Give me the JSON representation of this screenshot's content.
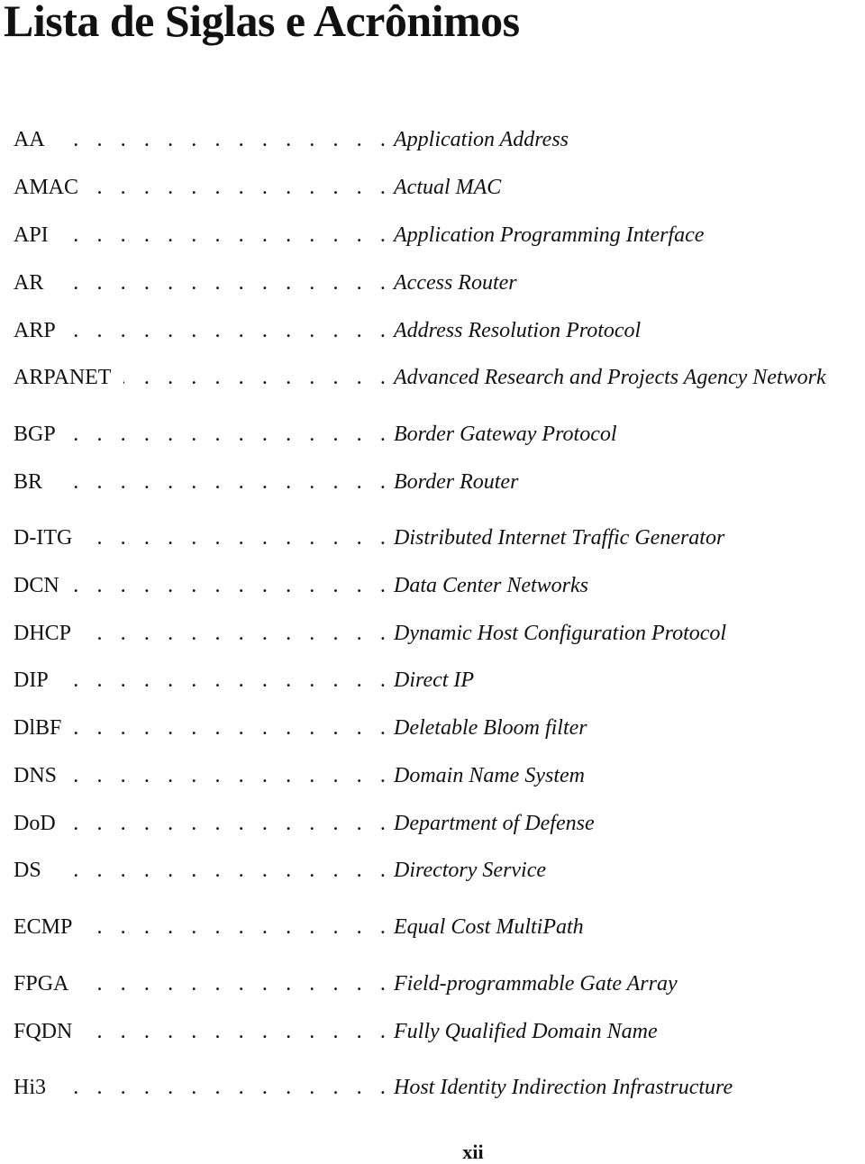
{
  "page": {
    "title": "Lista de Siglas e Acrônimos",
    "page_number": "xii"
  },
  "entries": [
    {
      "abbr": "AA",
      "definition": "Application Address"
    },
    {
      "abbr": "AMAC",
      "definition": "Actual MAC"
    },
    {
      "abbr": "API",
      "definition": "Application Programming Interface"
    },
    {
      "abbr": "AR",
      "definition": "Access Router"
    },
    {
      "abbr": "ARP",
      "definition": "Address Resolution Protocol"
    },
    {
      "abbr": "ARPANET",
      "definition": "Advanced Research and Projects Agency Network"
    },
    {
      "abbr": "BGP",
      "definition": "Border Gateway Protocol"
    },
    {
      "abbr": "BR",
      "definition": "Border Router"
    },
    {
      "abbr": "D-ITG",
      "definition": "Distributed Internet Traffic Generator"
    },
    {
      "abbr": "DCN",
      "definition": "Data Center Networks"
    },
    {
      "abbr": "DHCP",
      "definition": "Dynamic Host Configuration Protocol"
    },
    {
      "abbr": "DIP",
      "definition": "Direct IP"
    },
    {
      "abbr": "DlBF",
      "definition": "Deletable Bloom filter"
    },
    {
      "abbr": "DNS",
      "definition": "Domain Name System"
    },
    {
      "abbr": "DoD",
      "definition": "Department of Defense"
    },
    {
      "abbr": "DS",
      "definition": "Directory Service"
    },
    {
      "abbr": "ECMP",
      "definition": "Equal Cost MultiPath"
    },
    {
      "abbr": "FPGA",
      "definition": "Field-programmable Gate Array"
    },
    {
      "abbr": "FQDN",
      "definition": "Fully Qualified Domain Name"
    },
    {
      "abbr": "Hi3",
      "definition": "Host Identity Indirection Infrastructure"
    }
  ],
  "leader": ". . . . . . . . . . . . . . . . . . . . . . . . . . . . . . . . . . . . . . . . . ."
}
